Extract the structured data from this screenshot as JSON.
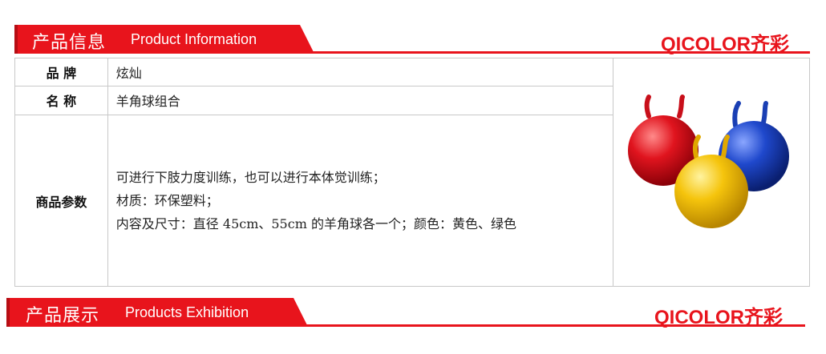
{
  "header": {
    "title_cn": "产品信息",
    "title_en": "Product Information",
    "logo_text": "QICOLOR",
    "logo_mark": "齐彩"
  },
  "table": {
    "rows": [
      {
        "label": "品 牌",
        "value": "炫灿"
      },
      {
        "label": "名 称",
        "value": "羊角球组合"
      },
      {
        "label": "商品参数",
        "lines": [
          "可进行下肢力度训练，也可以进行本体觉训练；",
          "材质：环保塑料；",
          "内容及尺寸：直径 45cm、55cm 的羊角球各一个；颜色：黄色、绿色"
        ]
      }
    ],
    "product_image": {
      "balls": [
        {
          "color": "#d8101c",
          "name": "red-ball"
        },
        {
          "color": "#1d46c8",
          "name": "blue-ball"
        },
        {
          "color": "#f4c20d",
          "name": "yellow-ball"
        }
      ]
    }
  },
  "footer": {
    "title_cn": "产品展示",
    "title_en": "Products Exhibition",
    "logo_text": "QICOLOR",
    "logo_mark": "齐彩"
  },
  "colors": {
    "accent": "#e8141c",
    "border": "#c8c8c8"
  }
}
